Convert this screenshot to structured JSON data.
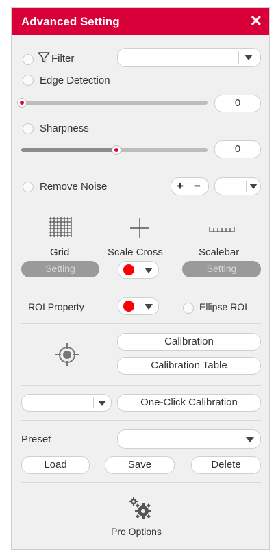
{
  "title": "Advanced Setting",
  "close_glyph": "✕",
  "filter": {
    "label": "Filter",
    "value": ""
  },
  "edge_detection": {
    "label": "Edge Detection",
    "value": "0",
    "level": 0
  },
  "sharpness": {
    "label": "Sharpness",
    "value": "0",
    "level": 0.5
  },
  "remove_noise": {
    "label": "Remove Noise",
    "plus": "+",
    "minus": "−",
    "value": ""
  },
  "tools": {
    "grid": {
      "label": "Grid",
      "button": "Setting"
    },
    "scale_cross": {
      "label": "Scale Cross",
      "color": "#ff0000"
    },
    "scalebar": {
      "label": "Scalebar",
      "button": "Setting"
    }
  },
  "roi": {
    "label": "ROI Property",
    "color": "#ff0000",
    "ellipse_label": "Ellipse ROI"
  },
  "calibration": {
    "button": "Calibration",
    "table_button": "Calibration Table"
  },
  "one_click": {
    "value": "",
    "button": "One-Click Calibration"
  },
  "preset": {
    "label": "Preset",
    "value": "",
    "load": "Load",
    "save": "Save",
    "delete": "Delete"
  },
  "pro_options": {
    "label": "Pro Options"
  },
  "colors": {
    "accent": "#d9003a",
    "marker": "#ff0000",
    "panel": "#f0f0f0"
  }
}
